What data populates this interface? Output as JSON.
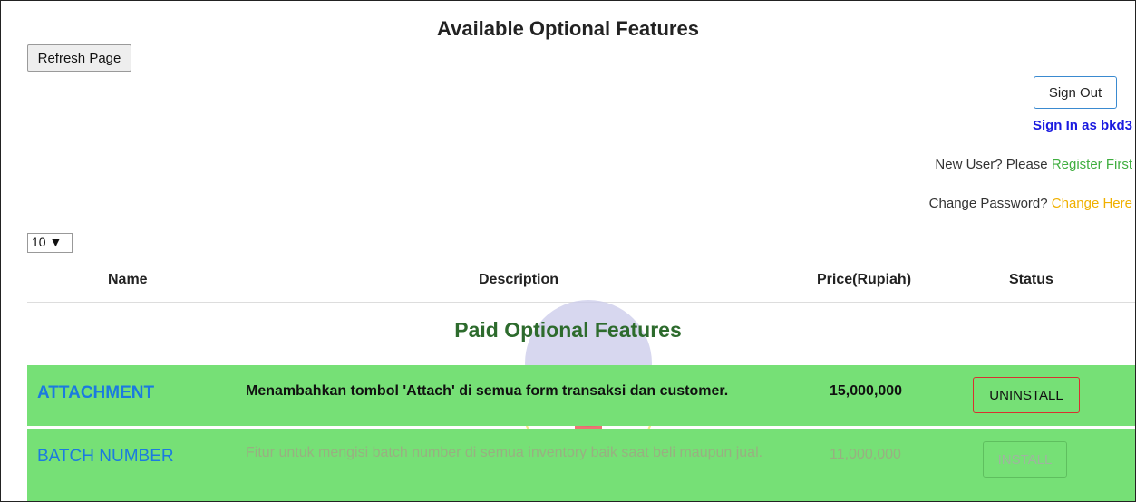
{
  "page": {
    "title": "Available Optional Features",
    "refresh_label": "Refresh Page"
  },
  "user": {
    "sign_out_label": "Sign Out",
    "signed_in_text": "Sign In as bkd3",
    "new_user_prefix": "New User? Please ",
    "register_link": "Register First",
    "change_pw_prefix": "Change Password? ",
    "change_link": "Change Here"
  },
  "table": {
    "page_size": "10 ▼",
    "columns": [
      "Name",
      "Description",
      "Price(Rupiah)",
      "Status"
    ],
    "section_title": "Paid Optional Features",
    "rows": [
      {
        "name": "ATTACHMENT",
        "description": "Menambahkan tombol 'Attach' di semua form transaksi dan customer.",
        "price": "15,000,000",
        "action": "UNINSTALL"
      },
      {
        "name": "BATCH NUMBER",
        "description": "Fitur untuk mengisi batch number di semua inventory baik saat beli maupun jual.",
        "price": "11,000,000",
        "action": "INSTALL"
      }
    ]
  },
  "colors": {
    "row_bg": "#76e076",
    "name_link": "#1b7ae0",
    "section_title": "#2d6b2d",
    "signed_in": "#1a1ae0",
    "register_link": "#3fae3f",
    "change_link": "#f0b000",
    "uninstall_border": "#d83030"
  },
  "icons": {
    "watermark": "leaf-logo-watermark"
  }
}
